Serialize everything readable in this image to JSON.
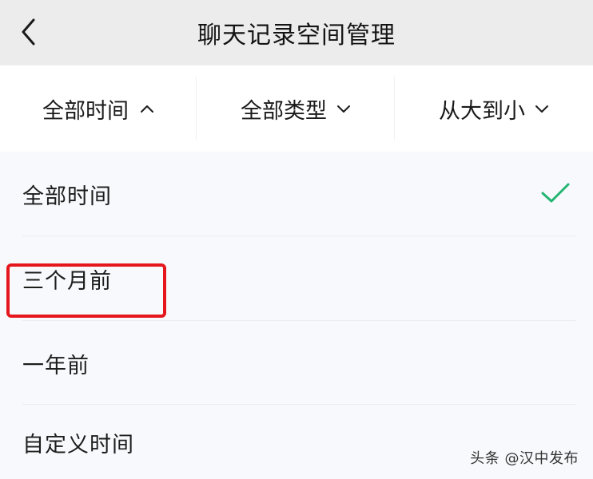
{
  "header": {
    "title": "聊天记录空间管理",
    "back_icon": "chevron-left-icon"
  },
  "filters": {
    "time": {
      "label": "全部时间",
      "icon": "chevron-up-icon"
    },
    "type": {
      "label": "全部类型",
      "icon": "chevron-down-icon"
    },
    "order": {
      "label": "从大到小",
      "icon": "chevron-down-icon"
    }
  },
  "time_options": [
    {
      "label": "全部时间",
      "selected": true
    },
    {
      "label": "三个月前",
      "selected": false
    },
    {
      "label": "一年前",
      "selected": false
    },
    {
      "label": "自定义时间",
      "selected": false,
      "highlighted": true
    }
  ],
  "colors": {
    "check": "#22b573",
    "highlight": "#e5171d",
    "header_bg": "#ececec"
  },
  "watermark": "头条 @汉中发布"
}
